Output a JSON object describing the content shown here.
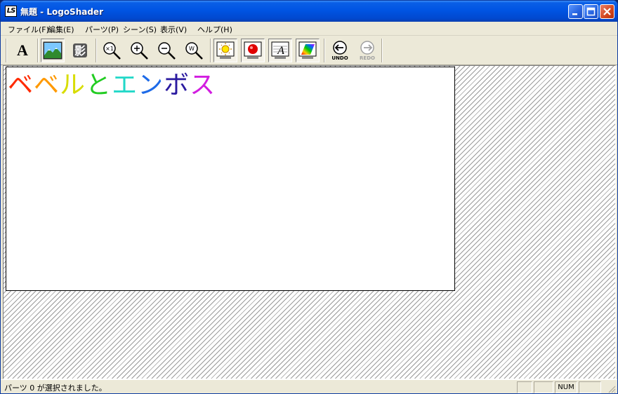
{
  "window": {
    "icon_text": "LS",
    "title": "無題 - LogoShader"
  },
  "menu": [
    {
      "label": "ファイル(F)"
    },
    {
      "label": "編集(E)"
    },
    {
      "label": "パーツ(P)"
    },
    {
      "label": "シーン(S)"
    },
    {
      "label": "表示(V)"
    },
    {
      "label": "ヘルプ(H)"
    }
  ],
  "toolbar": {
    "text_tool": "A",
    "zoom_1x": "×1",
    "zoom_fit": "W",
    "undo_label": "UNDO",
    "redo_label": "REDO"
  },
  "canvas": {
    "text": "ベベルとエンボス",
    "char_colors": [
      "#ff2a00",
      "#ff9900",
      "#d8dd00",
      "#22cc22",
      "#22d8c8",
      "#1e6be8",
      "#2b1aa0",
      "#d21ee0"
    ]
  },
  "status": {
    "message": "パーツ 0 が選択されました。",
    "num": "NUM"
  }
}
